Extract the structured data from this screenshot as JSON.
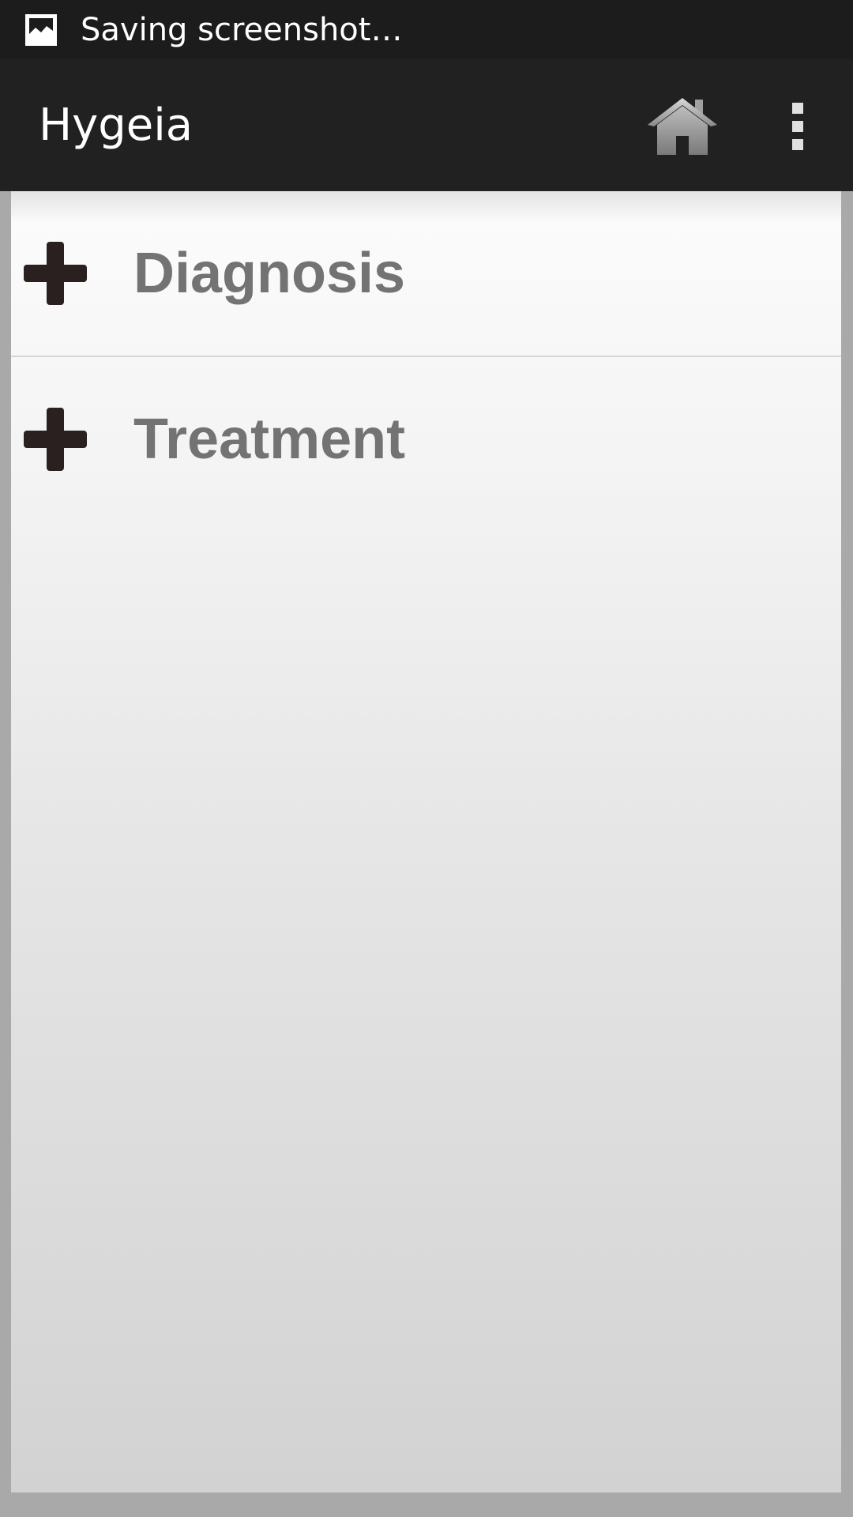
{
  "status_bar": {
    "notification_icon": "screenshot-image-icon",
    "text": "Saving screenshot…"
  },
  "app_bar": {
    "title": "Hygeia",
    "home_icon": "home-icon",
    "menu_icon": "overflow-menu-icon"
  },
  "list": {
    "items": [
      {
        "label": "Diagnosis",
        "icon": "plus-icon"
      },
      {
        "label": "Treatment",
        "icon": "plus-icon"
      }
    ]
  },
  "colors": {
    "status_bar": "#1c1c1c",
    "app_bar": "#212121",
    "label_text": "#737373",
    "plus_icon": "#2b2020"
  }
}
